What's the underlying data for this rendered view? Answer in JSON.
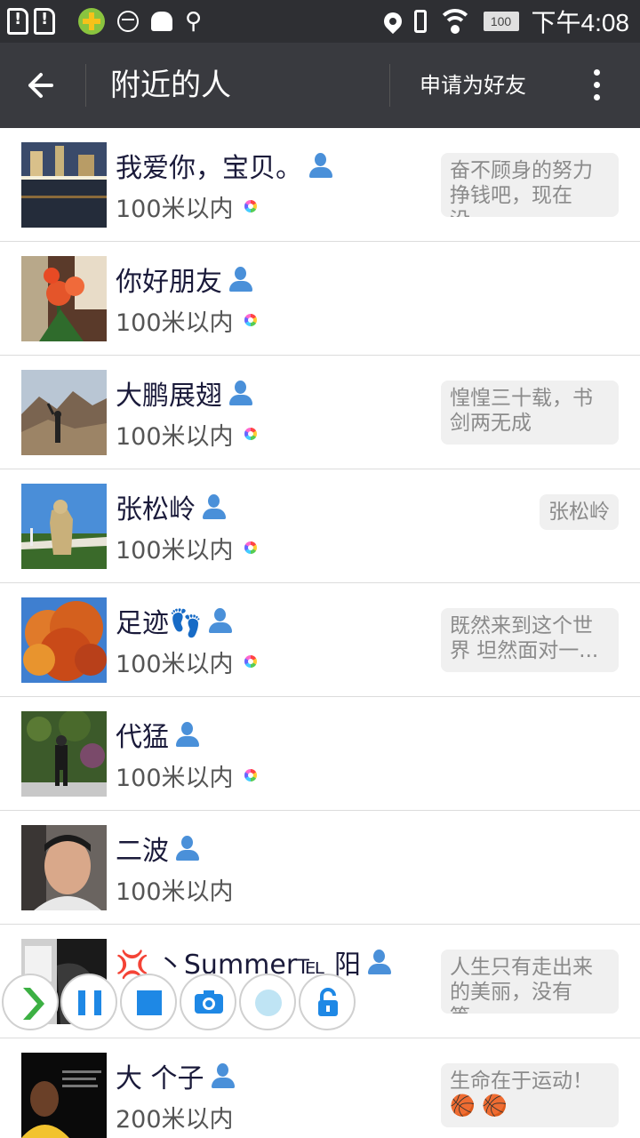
{
  "status_bar": {
    "time": "下午4:08",
    "battery": "100",
    "icons": [
      "sim-alert-icon",
      "sim-alert-icon",
      "360-app-icon",
      "face-icon",
      "android-icon",
      "usb-icon",
      "location-icon",
      "vibrate-icon",
      "wifi-icon",
      "battery-icon"
    ]
  },
  "appbar": {
    "back_icon": "arrow-left-icon",
    "title": "附近的人",
    "request_label": "申请为好友",
    "more_icon": "more-vert-icon"
  },
  "colors": {
    "status_bar_bg": "#2e2f33",
    "appbar_bg": "#393a3f",
    "person_icon": "#4a90d9",
    "signature_bg": "#f0f0f0"
  },
  "people": [
    {
      "name": "我爱你，宝贝。",
      "distance": "100米以内",
      "signature": "奋不顾身的努力挣钱吧，现在没...",
      "has_moments": true
    },
    {
      "name": "你好朋友",
      "distance": "100米以内",
      "signature": "",
      "has_moments": true
    },
    {
      "name": "大鹏展翅",
      "distance": "100米以内",
      "signature": "惶惶三十载，书剑两无成",
      "has_moments": true
    },
    {
      "name": "张松岭",
      "distance": "100米以内",
      "signature": "张松岭",
      "has_moments": true
    },
    {
      "name": "足迹👣",
      "distance": "100米以内",
      "signature": "既然来到这个世界  坦然面对一...",
      "has_moments": true
    },
    {
      "name": "代猛",
      "distance": "100米以内",
      "signature": "",
      "has_moments": true
    },
    {
      "name": "二波",
      "distance": "100米以内",
      "signature": "",
      "has_moments": false
    },
    {
      "name": "💢 丶Summer℡ 阳",
      "distance": "",
      "signature": "人生只有走出来的美丽，没有等...",
      "has_moments": false
    },
    {
      "name": "大 个子",
      "distance": "200米以内",
      "signature": "生命在于运动！🏀 🏀",
      "has_moments": false
    }
  ],
  "recorder_controls": [
    "expand-icon",
    "pause-icon",
    "stop-icon",
    "camera-icon",
    "record-icon",
    "unlock-icon"
  ]
}
